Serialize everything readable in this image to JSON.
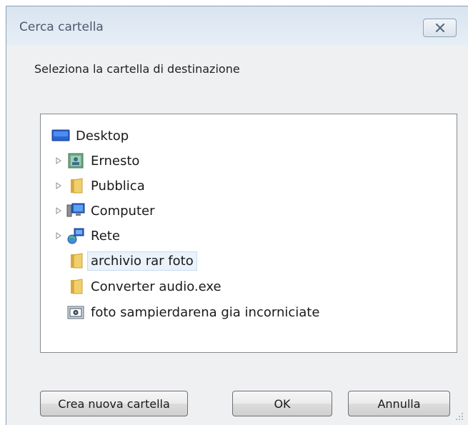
{
  "dialog": {
    "title": "Cerca cartella",
    "instruction": "Seleziona la cartella di destinazione"
  },
  "tree": {
    "items": [
      {
        "label": "Desktop",
        "icon": "desktop-icon",
        "expandable": false,
        "level": 0
      },
      {
        "label": "Ernesto",
        "icon": "user-folder-icon",
        "expandable": true,
        "level": 1
      },
      {
        "label": "Pubblica",
        "icon": "folder-icon",
        "expandable": true,
        "level": 1
      },
      {
        "label": "Computer",
        "icon": "computer-icon",
        "expandable": true,
        "level": 1
      },
      {
        "label": "Rete",
        "icon": "network-icon",
        "expandable": true,
        "level": 1
      },
      {
        "label": "archivio rar foto",
        "icon": "folder-icon",
        "expandable": false,
        "level": 1,
        "selected": true
      },
      {
        "label": "Converter audio.exe",
        "icon": "folder-icon",
        "expandable": false,
        "level": 1
      },
      {
        "label": "foto sampierdarena gia incorniciate",
        "icon": "image-folder-icon",
        "expandable": false,
        "level": 1
      }
    ]
  },
  "buttons": {
    "new_folder": "Crea nuova cartella",
    "ok": "OK",
    "cancel": "Annulla"
  },
  "colors": {
    "title_text": "#4a5a6e",
    "selection_bg": "#eaf2fb",
    "folder_yellow": "#e8c15a"
  }
}
